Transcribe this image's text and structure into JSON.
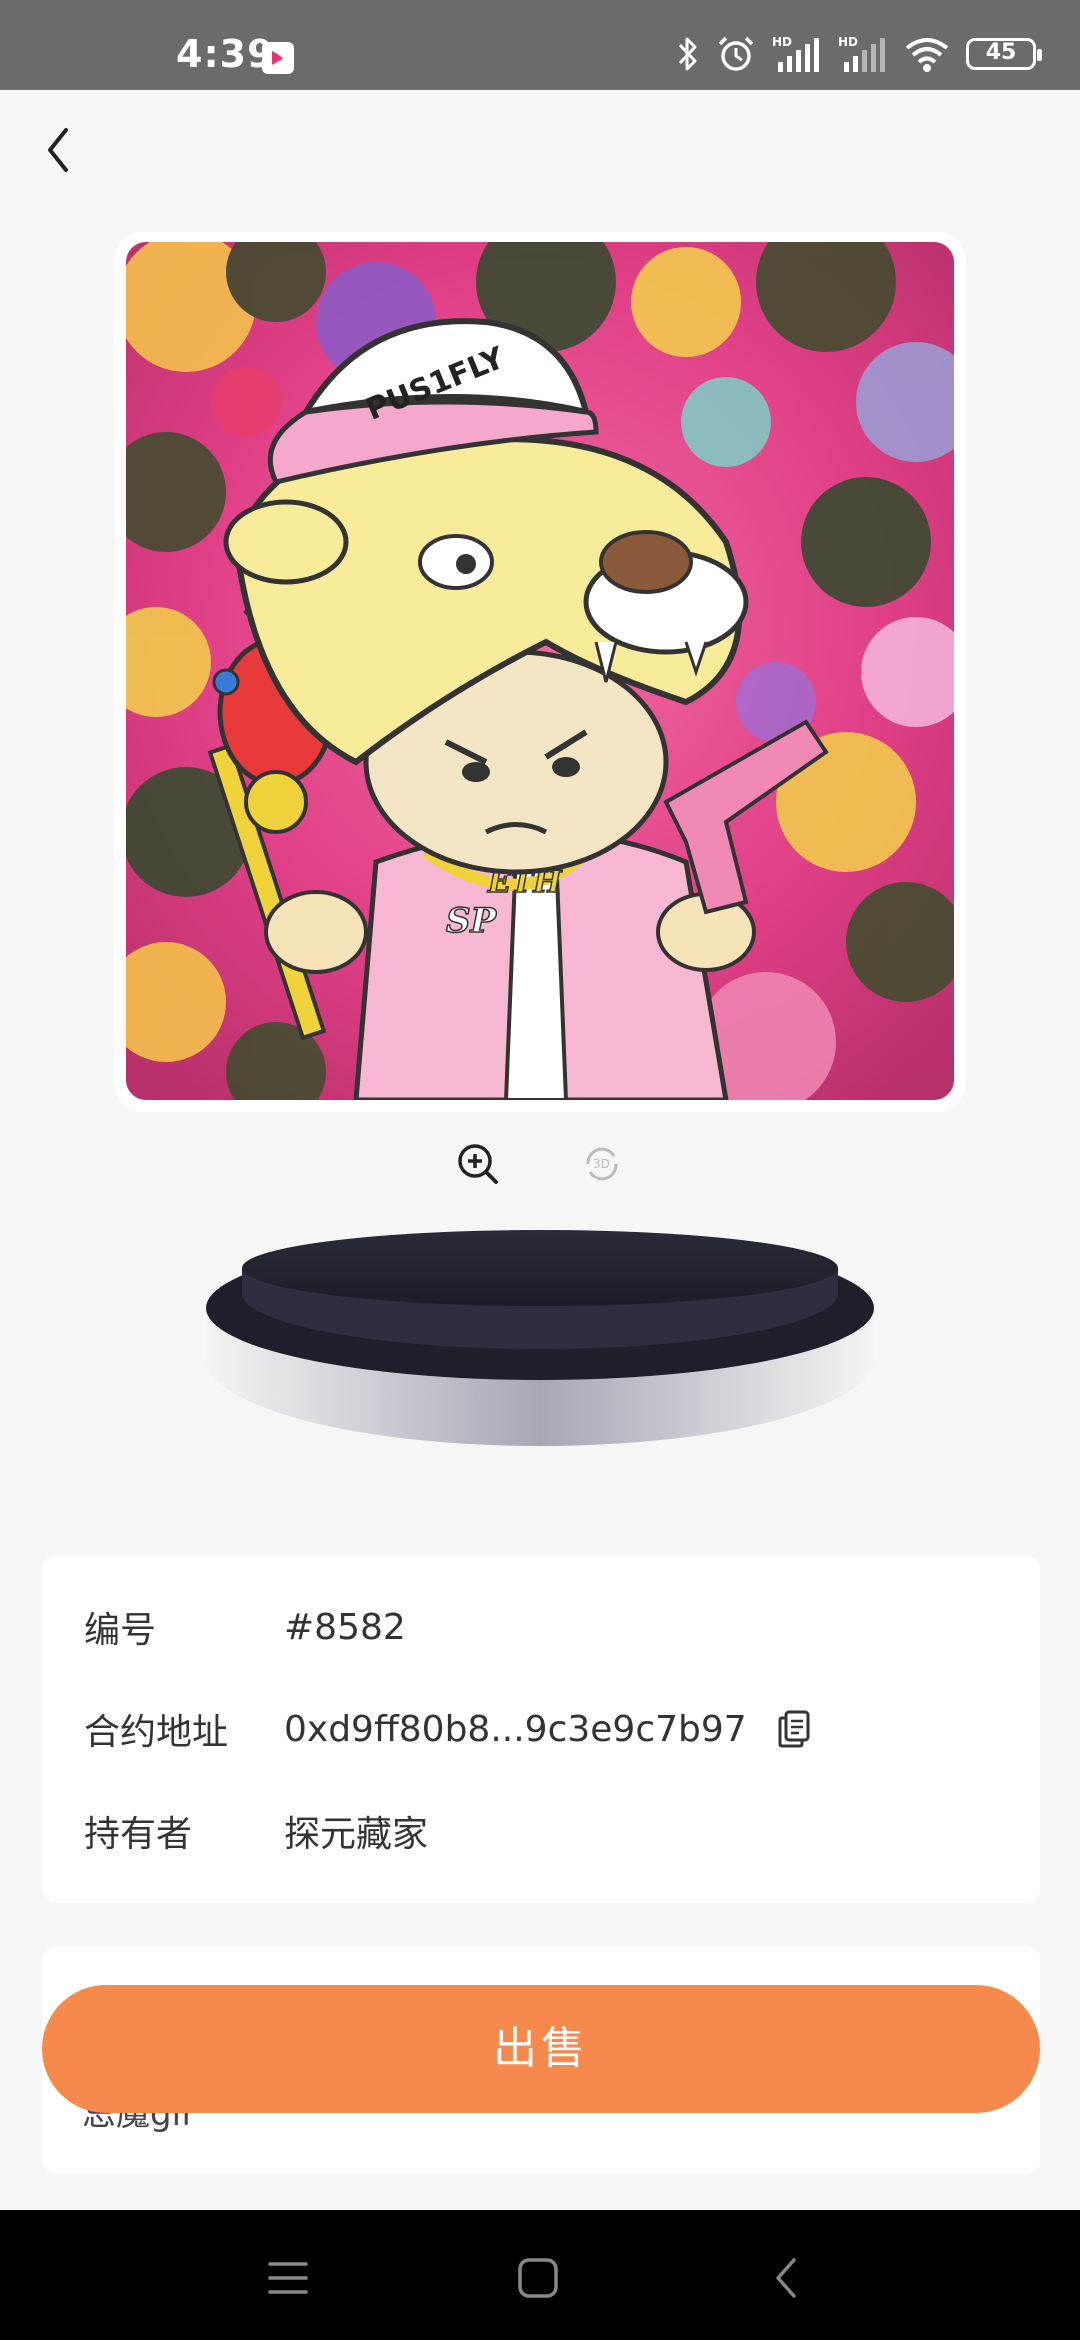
{
  "status_bar": {
    "time": "4:39",
    "battery_level": "45",
    "icons": [
      "app-notification-icon",
      "bluetooth-icon",
      "alarm-icon",
      "signal-hd-icon",
      "signal-hd-icon",
      "wifi-icon",
      "battery-icon"
    ]
  },
  "header": {
    "back_icon": "chevron-left-icon"
  },
  "artwork": {
    "name": "artwork-image",
    "cap_text": "PUS1FLY",
    "chain_text": "ETH",
    "jacket_text": "SP"
  },
  "viewer_tools": {
    "zoom_icon": "zoom-in-icon",
    "rotate_icon": "rotate-3d-icon",
    "rotate_label": "3D"
  },
  "info": {
    "rows": [
      {
        "label": "编号",
        "value": "#8582"
      },
      {
        "label": "合约地址",
        "value": "0xd9ff80b8...9c3e9c7b97"
      },
      {
        "label": "持有者",
        "value": "探元藏家"
      }
    ]
  },
  "description": {
    "partial_text": "忌魔gif"
  },
  "actions": {
    "sell_label": "出售"
  },
  "nav_bar": {
    "icons": [
      "menu-icon",
      "home-icon",
      "back-icon"
    ]
  },
  "colors": {
    "status_bar": "#6b6b6b",
    "accent": "#f58a4c",
    "background": "#f6f6f6",
    "card": "#ffffff"
  }
}
